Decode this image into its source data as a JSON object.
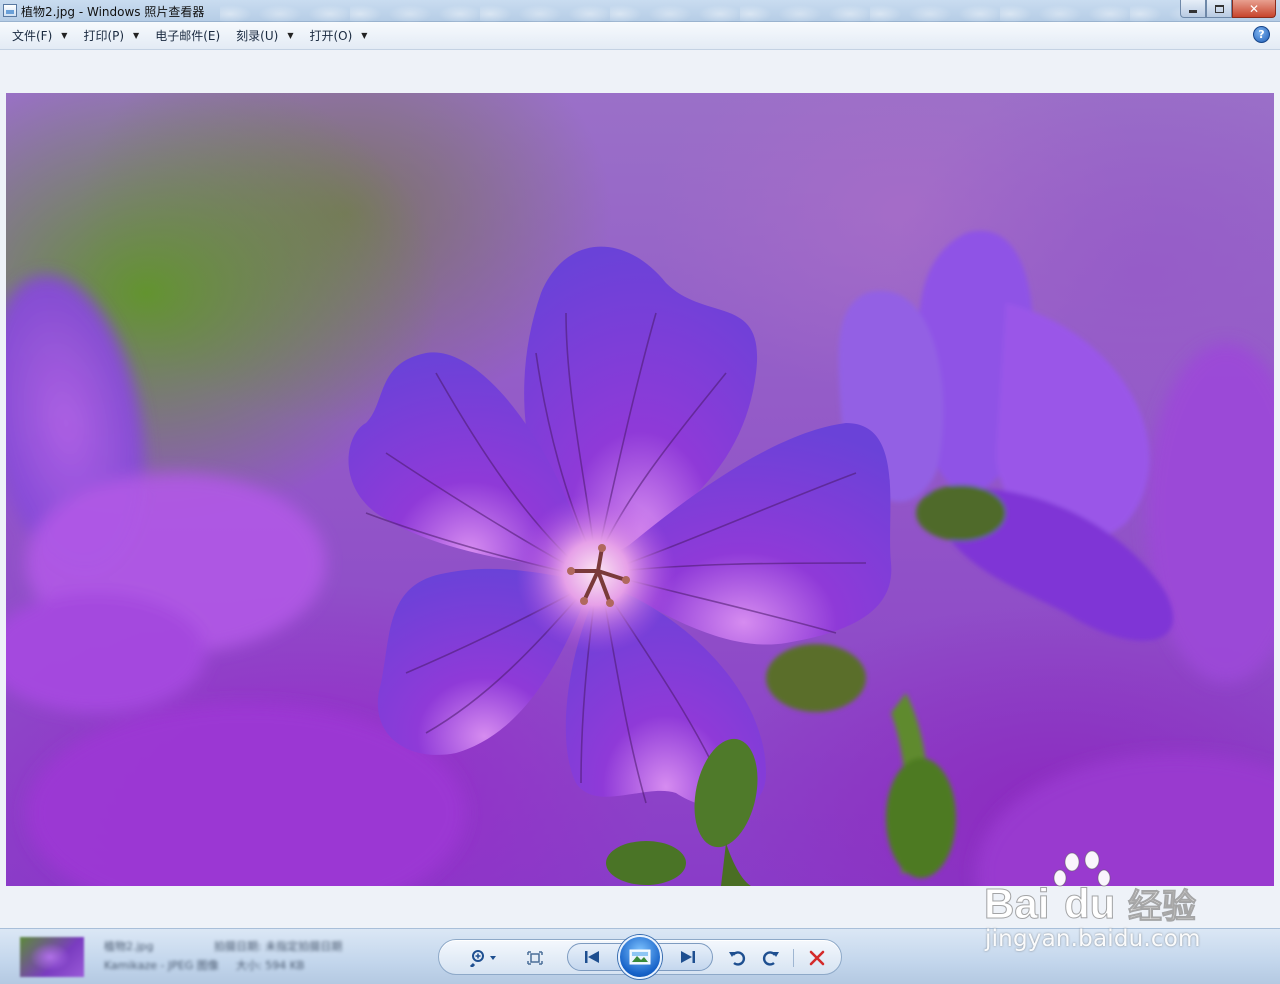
{
  "window": {
    "title": "植物2.jpg - Windows 照片查看器",
    "minimize_icon": "minimize-icon",
    "maximize_icon": "restore-icon",
    "close_label": "✕"
  },
  "menu": {
    "items": [
      {
        "label": "文件(F)",
        "has_dropdown": true
      },
      {
        "label": "打印(P)",
        "has_dropdown": true
      },
      {
        "label": "电子邮件(E)",
        "has_dropdown": false
      },
      {
        "label": "刻录(U)",
        "has_dropdown": true
      },
      {
        "label": "打开(O)",
        "has_dropdown": true
      }
    ],
    "help_label": "?"
  },
  "photo": {
    "filename": "植物2.jpg",
    "subject": "purple geranium flower"
  },
  "bottombar": {
    "info_name": "植物2.jpg",
    "info_meta": "Kamikaze - JPEG 图像",
    "info_date": "拍摄日期: 未指定拍摄日期",
    "info_size": "大小: 594 KB",
    "controls": {
      "zoom_icon": "zoom-icon",
      "actual_size_icon": "actual-size-icon",
      "previous_icon": "previous-icon",
      "slideshow_icon": "slideshow-icon",
      "next_icon": "next-icon",
      "rotate_ccw_icon": "rotate-counterclockwise-icon",
      "rotate_cw_icon": "rotate-clockwise-icon",
      "delete_icon": "delete-icon"
    }
  },
  "watermark": {
    "logo_text": "Bai du 经验",
    "url": "jingyan.baidu.com"
  },
  "colors": {
    "frame_bg": "#eef2f8",
    "accent": "#1662c8",
    "delete": "#d42a2a"
  }
}
